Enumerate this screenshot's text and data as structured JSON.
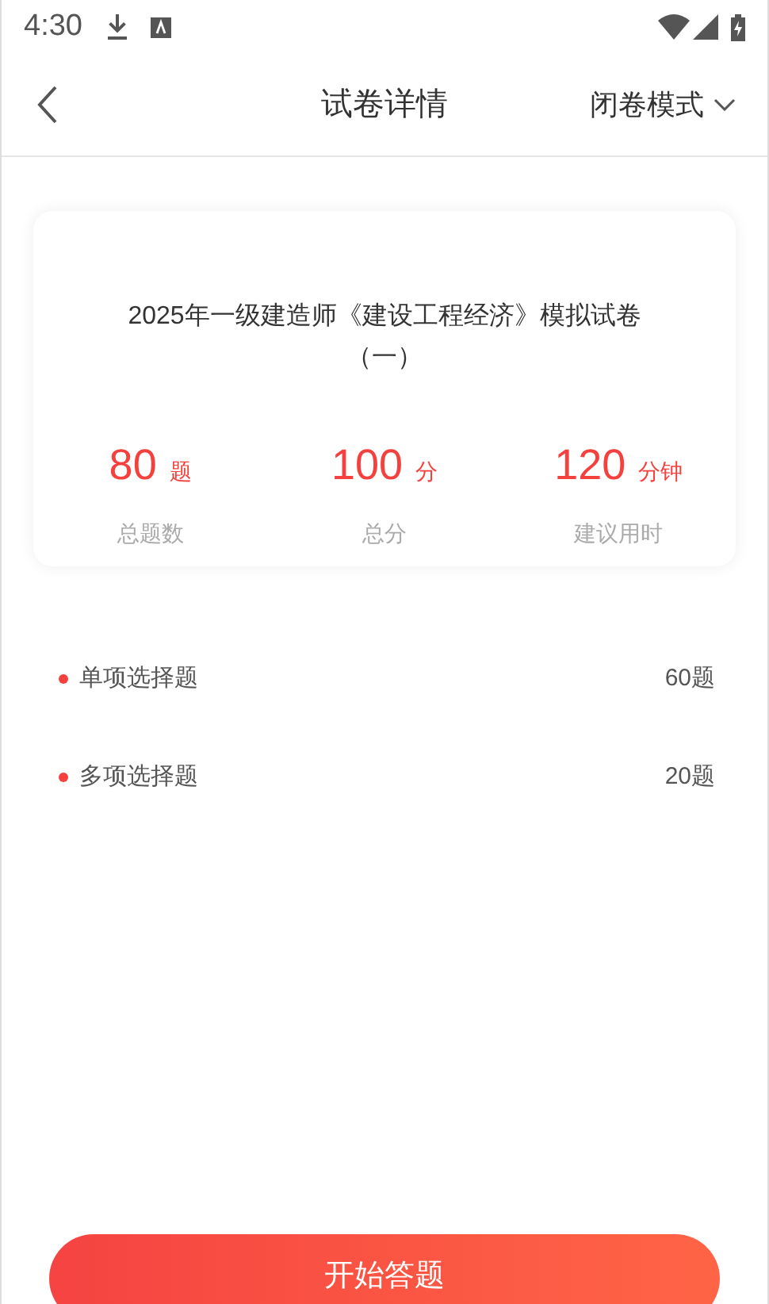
{
  "status_bar": {
    "time": "4:30"
  },
  "header": {
    "title": "试卷详情",
    "mode": "闭卷模式"
  },
  "paper": {
    "title": "2025年一级建造师《建设工程经济》模拟试卷（一）",
    "stats": [
      {
        "value": "80",
        "unit": "题",
        "label": "总题数"
      },
      {
        "value": "100",
        "unit": "分",
        "label": "总分"
      },
      {
        "value": "120",
        "unit": "分钟",
        "label": "建议用时"
      }
    ]
  },
  "sections": [
    {
      "name": "单项选择题",
      "count": "60题"
    },
    {
      "name": "多项选择题",
      "count": "20题"
    }
  ],
  "start_button": "开始答题"
}
